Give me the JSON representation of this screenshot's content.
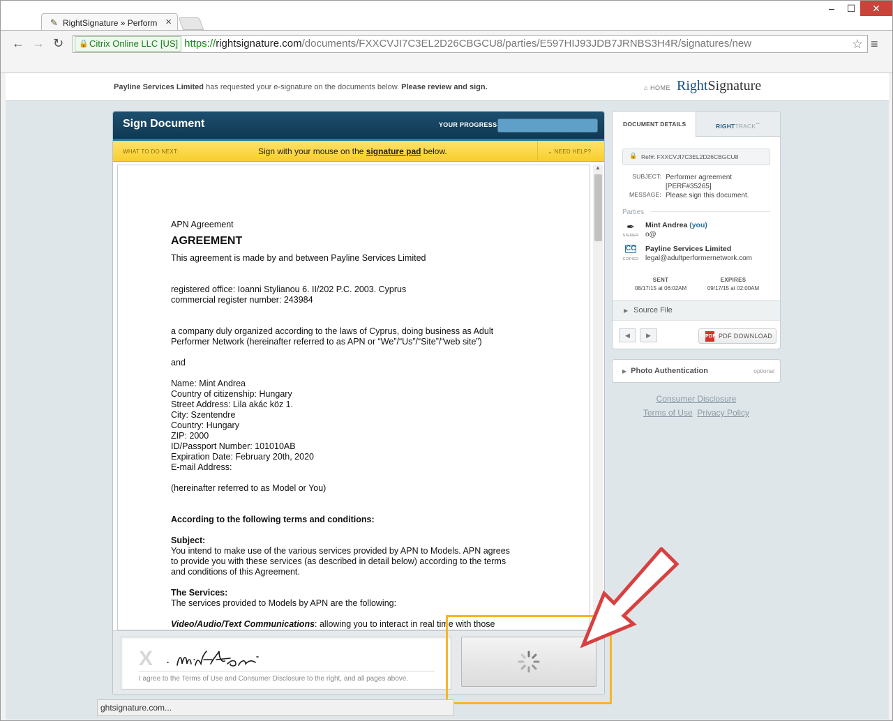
{
  "browser": {
    "tab_title": "RightSignature » Perform",
    "ev_badge": "Citrix Online LLC [US]",
    "url_scheme": "https://",
    "url_host": "rightsignature.com",
    "url_path": "/documents/FXXCVJI7C3EL2D26CBGCU8/parties/E597HIJ93JDB7JRNBS3H4R/signatures/new",
    "status_text": "ghtsignature.com..."
  },
  "header": {
    "requester": "Payline Services Limited",
    "request_text": " has requested your e-signature on the documents below. ",
    "request_cta": "Please review and sign.",
    "home_label": "HOME",
    "logo_right": "Right",
    "logo_sig": "Signature"
  },
  "sign_panel": {
    "title": "Sign Document",
    "progress_label": "YOUR PROGRESS",
    "progress_value": 1.0,
    "what_next_label": "WHAT TO DO NEXT:",
    "what_next_pre": "Sign with your mouse on the ",
    "what_next_link": "signature pad",
    "what_next_post": " below.",
    "help_label": "NEED HELP?"
  },
  "document": {
    "doc_title": "APN Agreement",
    "heading": "AGREEMENT",
    "intro": "This agreement is made by and between Payline Services Limited",
    "office": "registered office: Ioanni Stylianou 6. II/202 P.C. 2003. Cyprus",
    "register": "commercial register number: 243984",
    "company": "a company duly organized according to the laws of Cyprus, doing business as Adult Performer Network (hereinafter referred to as APN or “We”/“Us”/“Site”/“web site”)",
    "and": "and",
    "name": "Name: Mint Andrea",
    "citizenship": "Country of citizenship: Hungary",
    "street": "Street Address: Lila akác köz 1.",
    "city": "City: Szentendre",
    "country": "Country: Hungary",
    "zip": "ZIP: 2000",
    "passport": "ID/Passport Number: 101010AB",
    "expiration": "Expiration Date: February 20th, 2020",
    "email": "E-mail Address:",
    "referred": "(hereinafter referred to as Model or You)",
    "terms_heading": "According to the following terms and conditions:",
    "subject_heading": "Subject:",
    "subject_text": "You intend to make use of the various services provided by APN to Models. APN agrees to provide you with these services (as described in detail below) according to the terms and conditions of this Agreement.",
    "services_heading": "The Services:",
    "services_text": "The services provided to Models by APN are the following:",
    "video_heading": "Video/Audio/Text Communications",
    "video_text": ": allowing you to interact in real time with those"
  },
  "signature_pad": {
    "x_mark": "X",
    "agreement": "I agree to the Terms of Use and Consumer Disclosure to the right, and all pages above."
  },
  "details": {
    "tab_details": "DOCUMENT DETAILS",
    "tab_track_bold": "RIGHT",
    "tab_track_rest": "TRACK",
    "tab_track_tm": "™",
    "ref_label": "Ref#: FXXCVJI7C3EL2D26CBGCU8",
    "subject_key": "SUBJECT:",
    "subject_val": "Performer agreement [PERF#35265]",
    "message_key": "MESSAGE:",
    "message_val": "Please sign this document.",
    "parties_label": "Parties",
    "signer_role": "SIGNER",
    "signer_name": "Mint Andrea",
    "signer_you": " (you)",
    "signer_email": "o@",
    "cc_role": "COPIED",
    "cc_name": "Payline Services Limited",
    "cc_email": "legal@adultperformernetwork.com",
    "sent_label": "SENT",
    "sent_value": "08/17/15 at 06:02AM",
    "expires_label": "EXPIRES",
    "expires_value": "09/17/15 at 02:00AM",
    "source_file": "Source File",
    "pdf_download": "PDF DOWNLOAD",
    "pdf_icon": "PDF"
  },
  "photo_auth": {
    "label": "Photo Authentication",
    "optional": "optional"
  },
  "footer_links": {
    "consumer": "Consumer Disclosure",
    "terms": "Terms of Use",
    "privacy": "Privacy Policy"
  },
  "icons": {
    "tab_icon": "rightsignature-pen-icon",
    "annotation": "red-arrow-icon",
    "highlight": "orange-highlight-box"
  },
  "colors": {
    "header_navy": "#0f3953",
    "instruction_yellow": "#f8cf2c",
    "annotation_red": "#d84040",
    "highlight_orange": "#f7b527"
  }
}
